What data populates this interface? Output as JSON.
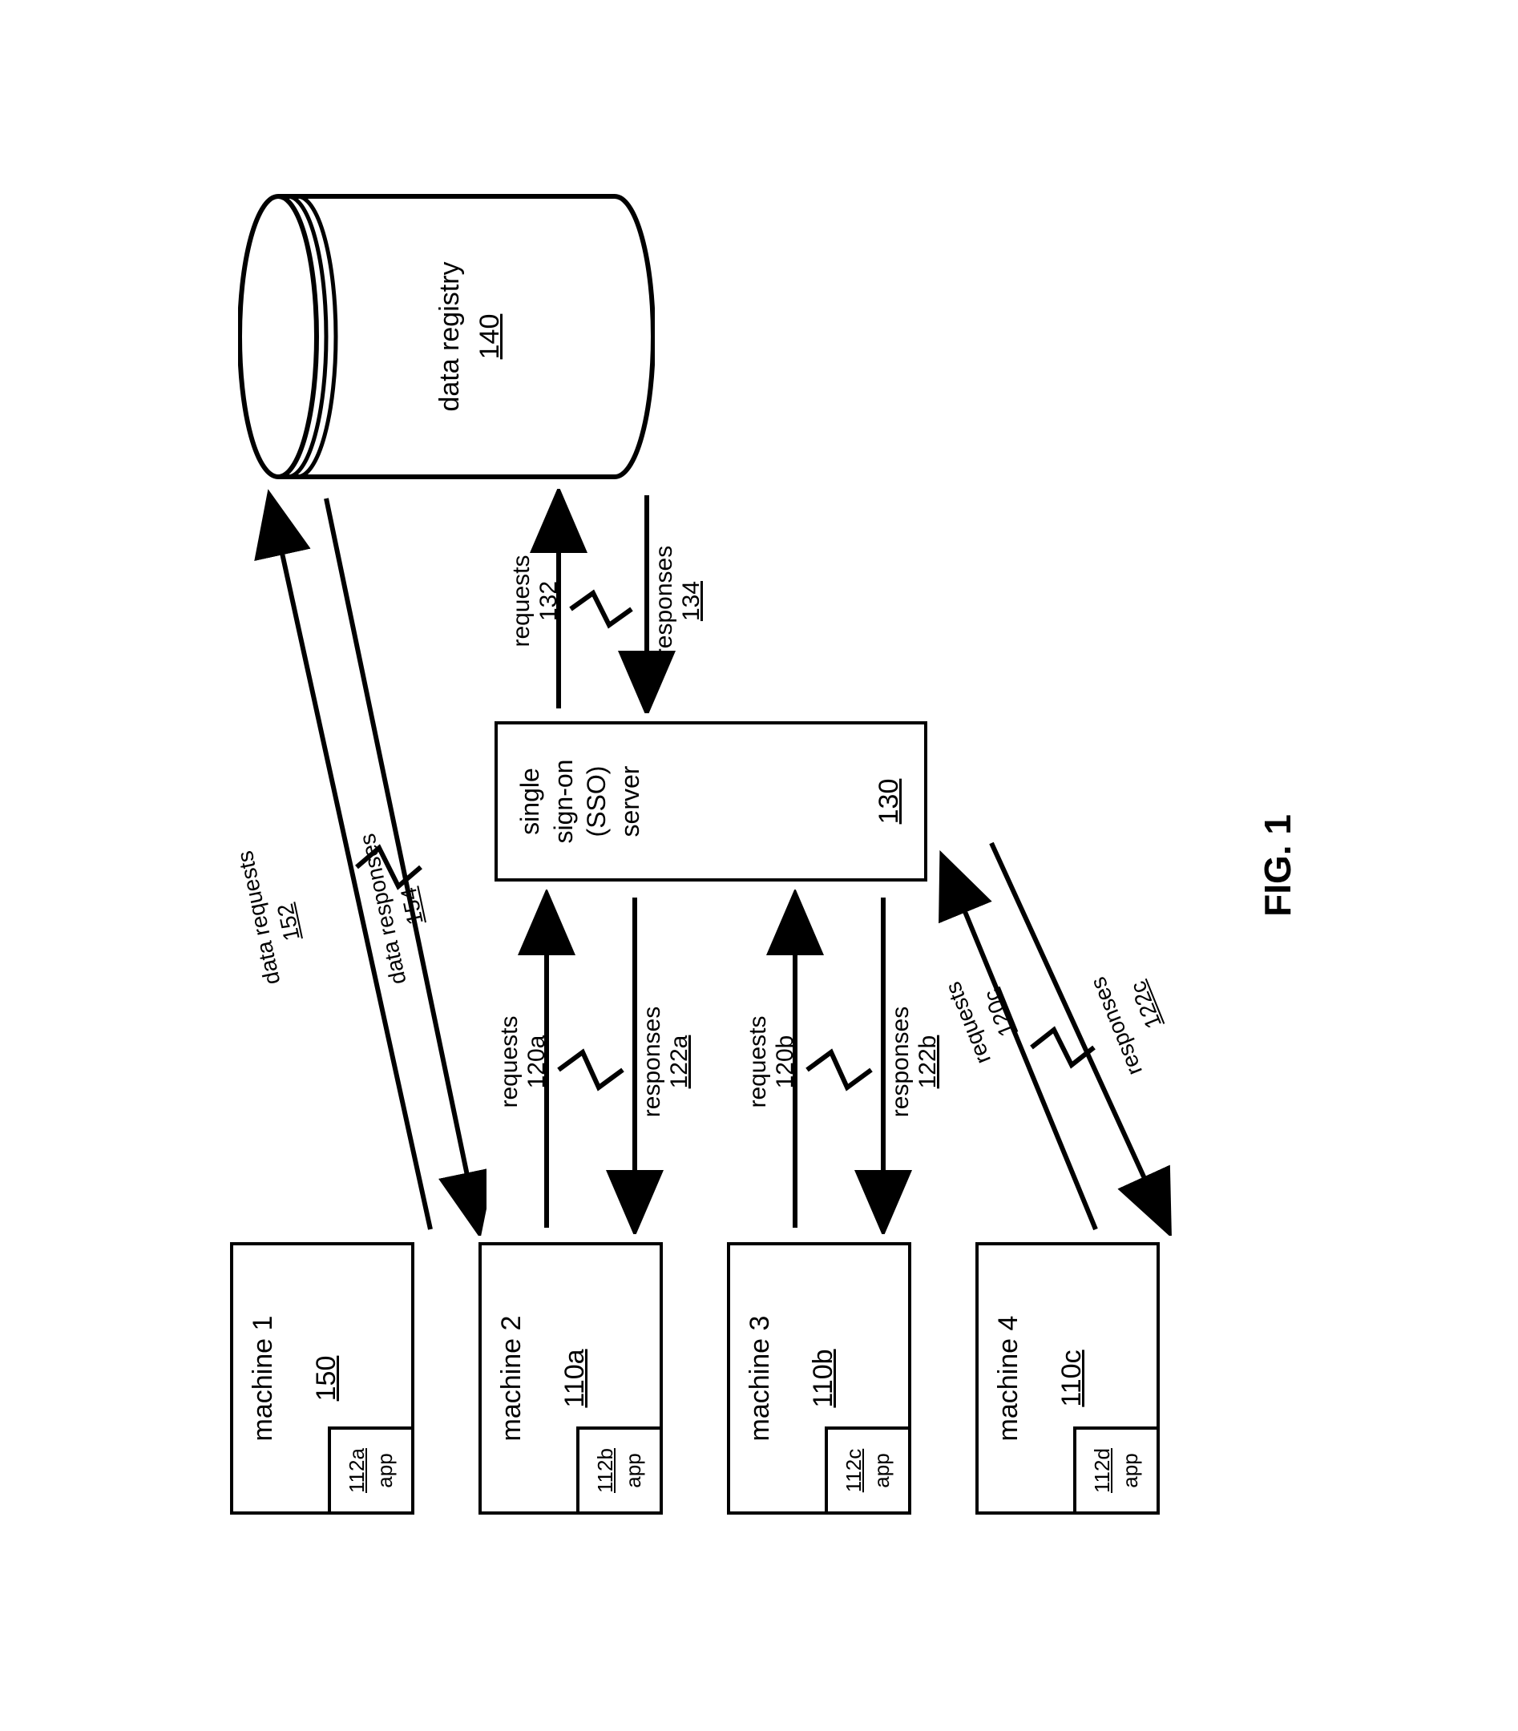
{
  "figure_caption": "FIG. 1",
  "machines": {
    "m1": {
      "title": "machine 1",
      "ref": "150",
      "app_ref": "112a",
      "app_label": "app"
    },
    "m2": {
      "title": "machine 2",
      "ref": "110a",
      "app_ref": "112b",
      "app_label": "app"
    },
    "m3": {
      "title": "machine 3",
      "ref": "110b",
      "app_ref": "112c",
      "app_label": "app"
    },
    "m4": {
      "title": "machine 4",
      "ref": "110c",
      "app_ref": "112d",
      "app_label": "app"
    }
  },
  "sso": {
    "line1": "single",
    "line2": "sign-on",
    "line3": "(SSO)",
    "line4": "server",
    "ref": "130"
  },
  "registry": {
    "label": "data registry",
    "ref": "140"
  },
  "arrows": {
    "data_req": {
      "label": "data requests",
      "ref": "152"
    },
    "data_resp": {
      "label": "data responses",
      "ref": "154"
    },
    "a120a": {
      "label": "requests",
      "ref": "120a"
    },
    "a122a": {
      "label": "responses",
      "ref": "122a"
    },
    "a120b": {
      "label": "requests",
      "ref": "120b"
    },
    "a122b": {
      "label": "responses",
      "ref": "122b"
    },
    "a120c": {
      "label": "requests",
      "ref": "120c"
    },
    "a122c": {
      "label": "responses",
      "ref": "122c"
    },
    "a132": {
      "label": "requests",
      "ref": "132"
    },
    "a134": {
      "label": "responses",
      "ref": "134"
    }
  }
}
